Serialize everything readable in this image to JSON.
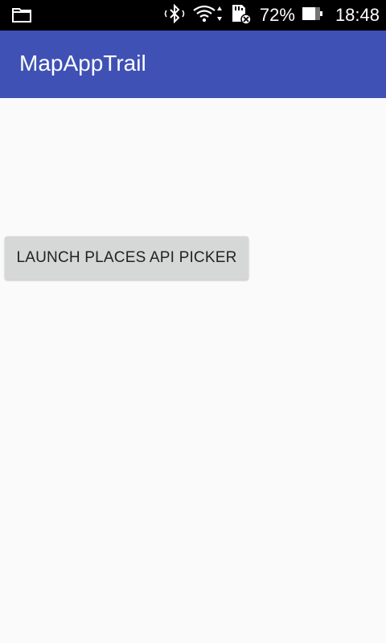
{
  "status_bar": {
    "notification_icon": "folder-icon",
    "icons": [
      "bluetooth-icon",
      "wifi-icon",
      "sd-card-icon"
    ],
    "battery_percent": "72%",
    "time": "18:48"
  },
  "app_bar": {
    "title": "MapAppTrail",
    "color": "#3f51b5"
  },
  "main": {
    "launch_button_label": "LAUNCH PLACES API PICKER"
  }
}
